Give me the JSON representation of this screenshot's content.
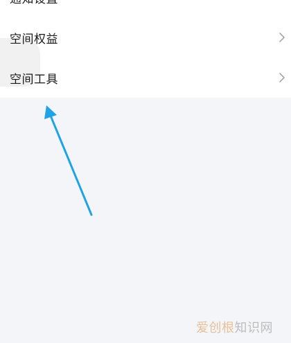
{
  "settings_list": {
    "items": [
      {
        "label": "通知设置",
        "has_chevron": false
      },
      {
        "label": "空间权益",
        "has_chevron": true
      },
      {
        "label": "空间工具",
        "has_chevron": true
      }
    ]
  },
  "watermark": {
    "brand": "爱创根",
    "suffix": "知识网"
  },
  "colors": {
    "page_background": "#f4f5f9",
    "list_background": "#ffffff",
    "annotation_arrow": "#1fa3e6"
  }
}
